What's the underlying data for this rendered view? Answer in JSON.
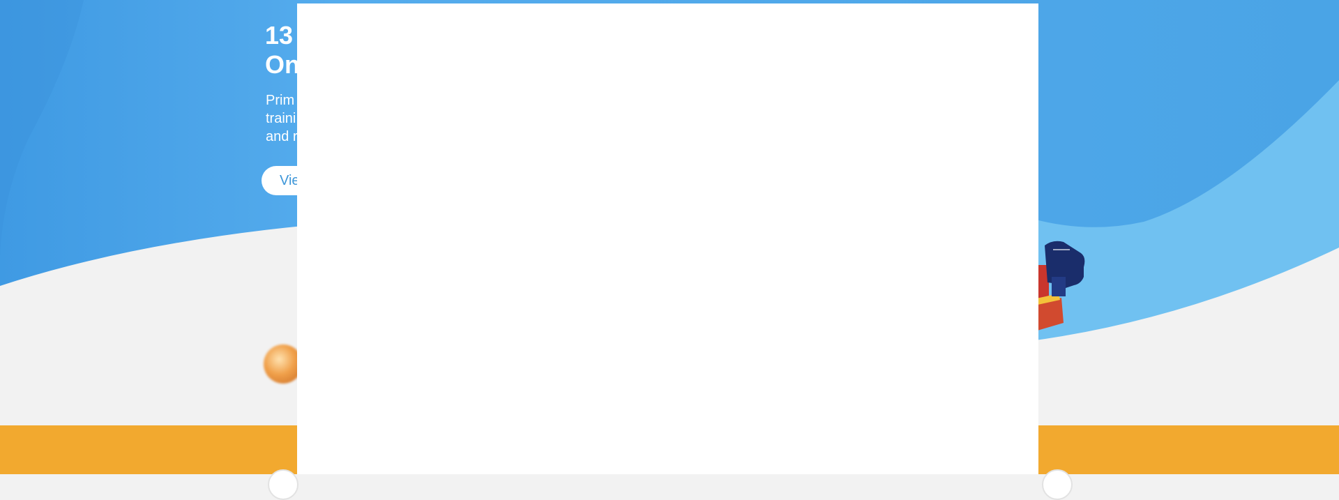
{
  "hero": {
    "title_line1": "13",
    "title_line2": "On",
    "text_line1": "Prim",
    "text_line2": "traini",
    "text_line3": "and r",
    "button_label": "Vie"
  },
  "modal": {
    "content": ""
  },
  "colors": {
    "hero_blue": "#4aa4e6",
    "light_blue": "#70c1f1",
    "orange_band": "#f2a92f",
    "background": "#f2f2f2"
  }
}
